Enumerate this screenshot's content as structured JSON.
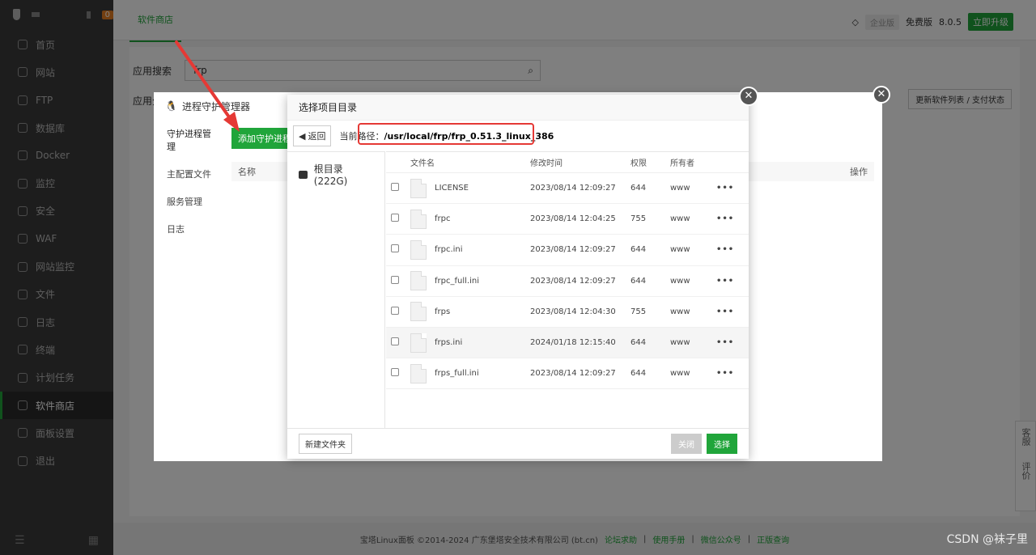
{
  "sidebar": {
    "badge": "0",
    "items": [
      {
        "label": "首页"
      },
      {
        "label": "网站"
      },
      {
        "label": "FTP"
      },
      {
        "label": "数据库"
      },
      {
        "label": "Docker"
      },
      {
        "label": "监控"
      },
      {
        "label": "安全"
      },
      {
        "label": "WAF"
      },
      {
        "label": "网站监控"
      },
      {
        "label": "文件"
      },
      {
        "label": "日志"
      },
      {
        "label": "终端"
      },
      {
        "label": "计划任务"
      },
      {
        "label": "软件商店"
      },
      {
        "label": "面板设置"
      },
      {
        "label": "退出"
      }
    ],
    "active_index": 13
  },
  "topbar": {
    "tab": "软件商店",
    "enterprise": "企业版",
    "edition": "免费版",
    "version": "8.0.5",
    "upgrade": "立即升级"
  },
  "store": {
    "search_label": "应用搜索",
    "search_value": "frp",
    "category_label": "应用分",
    "update_btn": "更新软件列表 / 支付状态"
  },
  "outer_dialog": {
    "title": "进程守护管理器",
    "nav": [
      "守护进程管理",
      "主配置文件",
      "服务管理",
      "日志"
    ],
    "add_button": "添加守护进程",
    "col_name": "名称",
    "col_action": "操作"
  },
  "file_dialog": {
    "title": "选择项目目录",
    "back": "返回",
    "path_label": "当前路径：",
    "path": "/usr/local/frp/frp_0.51.3_linux_386",
    "root": "根目录 (222G)",
    "columns": {
      "name": "文件名",
      "mtime": "修改时间",
      "perm": "权限",
      "owner": "所有者"
    },
    "files": [
      {
        "name": "LICENSE",
        "mtime": "2023/08/14 12:09:27",
        "perm": "644",
        "owner": "www"
      },
      {
        "name": "frpc",
        "mtime": "2023/08/14 12:04:25",
        "perm": "755",
        "owner": "www"
      },
      {
        "name": "frpc.ini",
        "mtime": "2023/08/14 12:09:27",
        "perm": "644",
        "owner": "www"
      },
      {
        "name": "frpc_full.ini",
        "mtime": "2023/08/14 12:09:27",
        "perm": "644",
        "owner": "www"
      },
      {
        "name": "frps",
        "mtime": "2023/08/14 12:04:30",
        "perm": "755",
        "owner": "www"
      },
      {
        "name": "frps.ini",
        "mtime": "2024/01/18 12:15:40",
        "perm": "644",
        "owner": "www"
      },
      {
        "name": "frps_full.ini",
        "mtime": "2023/08/14 12:09:27",
        "perm": "644",
        "owner": "www"
      }
    ],
    "more": "•••",
    "new_folder": "新建文件夹",
    "close": "关闭",
    "select": "选择"
  },
  "footer": {
    "copyright": "宝塔Linux面板 ©2014-2024 广东堡塔安全技术有限公司 (bt.cn)",
    "links": [
      "论坛求助",
      "使用手册",
      "微信公众号",
      "正版查询"
    ]
  },
  "side_float": [
    "客服",
    "评价"
  ],
  "watermark": "CSDN @袜子里",
  "colors": {
    "accent": "#20a53a",
    "highlight_box": "#e53935",
    "sidebar": "#3a3a3a"
  }
}
